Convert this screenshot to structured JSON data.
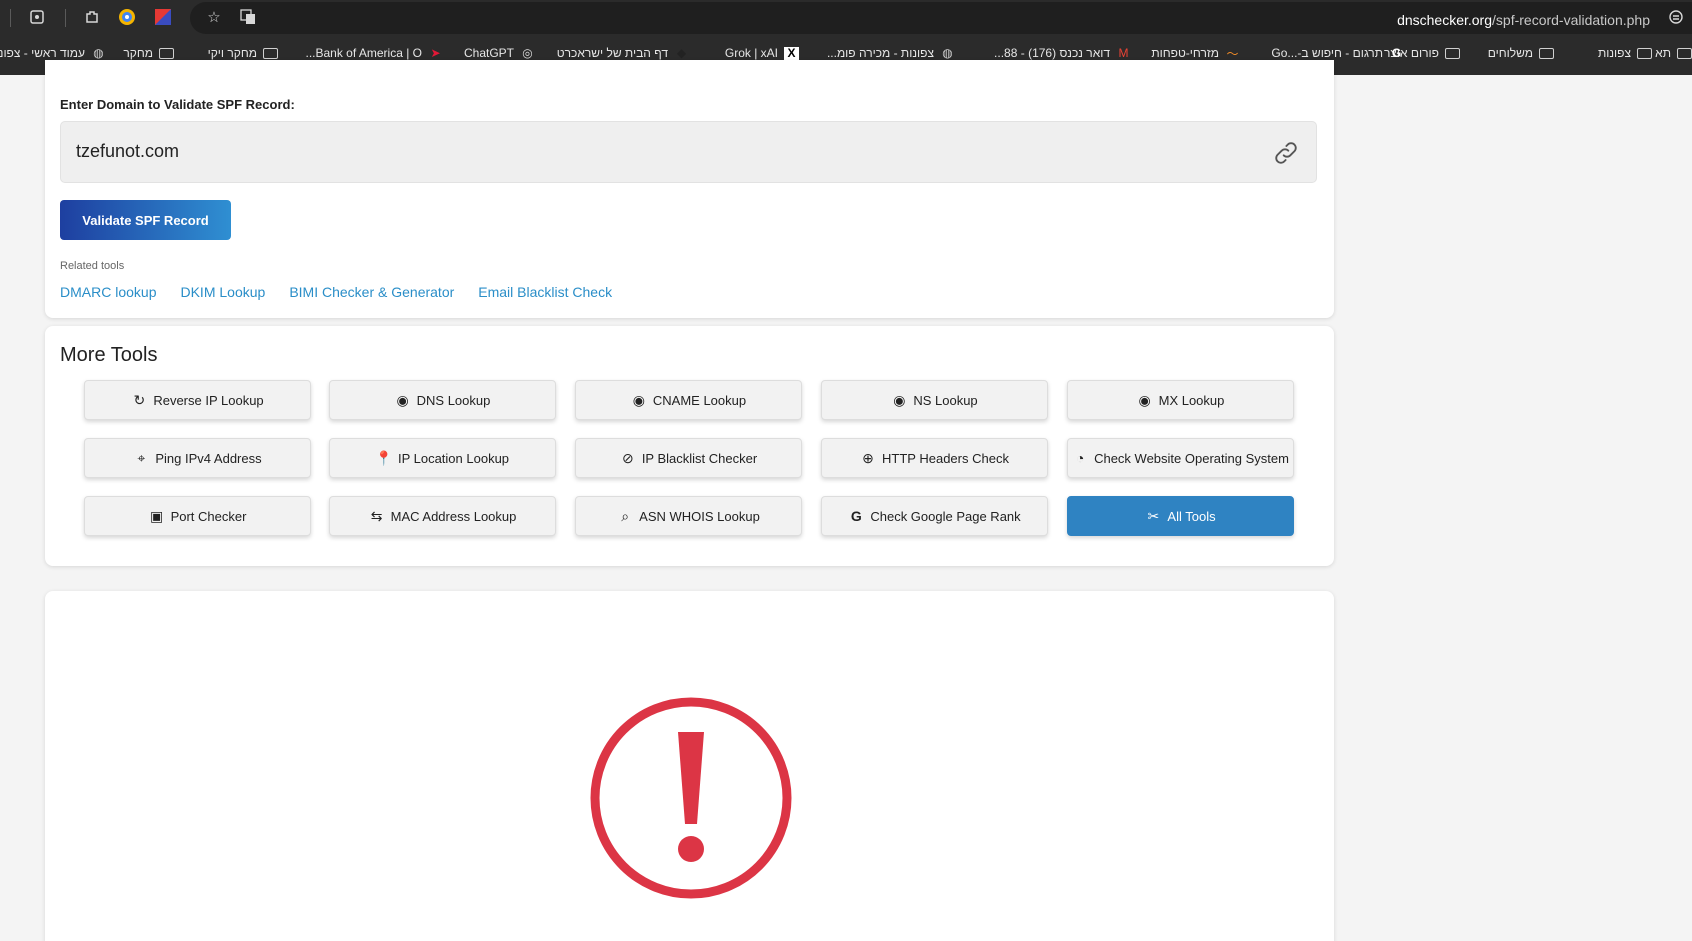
{
  "browser": {
    "url_host": "dnschecker.org",
    "url_path": "/spf-record-validation.php"
  },
  "bookmarks": [
    {
      "label": "תא",
      "icon": "folder-icon"
    },
    {
      "label": "צפונות",
      "icon": "folder-icon"
    },
    {
      "label": "משלוחים",
      "icon": "folder-icon"
    },
    {
      "label": "פורום אוצר",
      "icon": "folder-icon"
    },
    {
      "label": "תרגום - חיפוש ב-...Go",
      "icon": "google-icon"
    },
    {
      "label": "מזרחי-טפחות",
      "icon": "bank-icon"
    },
    {
      "label": "דואר נכנס (176) - 88...",
      "icon": "gmail-icon"
    },
    {
      "label": "צפונות - מכירה פומ...",
      "icon": "globe-icon"
    },
    {
      "label": "Grok | xAI",
      "icon": "x-icon"
    },
    {
      "label": "דף הבית של ישראכרט",
      "icon": "isracard-icon"
    },
    {
      "label": "ChatGPT",
      "icon": "chatgpt-icon"
    },
    {
      "label": "Bank of America | O...",
      "icon": "boa-icon"
    },
    {
      "label": "מחקר ויקי",
      "icon": "folder-icon"
    },
    {
      "label": "מחקר",
      "icon": "folder-icon"
    },
    {
      "label": "עמוד ראשי - צפונות...",
      "icon": "globe-icon"
    }
  ],
  "form": {
    "label": "Enter Domain to Validate SPF Record:",
    "domain_value": "tzefunot.com",
    "validate_label": "Validate SPF Record",
    "related_title": "Related tools",
    "related_links": [
      "DMARC lookup",
      "DKIM Lookup",
      "BIMI Checker & Generator",
      "Email Blacklist Check"
    ]
  },
  "more_tools": {
    "title": "More Tools",
    "rows": [
      [
        {
          "label": "Reverse IP Lookup",
          "icon": "refresh-icon"
        },
        {
          "label": "DNS Lookup",
          "icon": "dns-icon"
        },
        {
          "label": "CNAME Lookup",
          "icon": "dns-icon"
        },
        {
          "label": "NS Lookup",
          "icon": "dns-icon"
        },
        {
          "label": "MX Lookup",
          "icon": "dns-icon"
        }
      ],
      [
        {
          "label": "Ping IPv4 Address",
          "icon": "pin-outline-icon"
        },
        {
          "label": "IP Location Lookup",
          "icon": "pin-icon"
        },
        {
          "label": "IP Blacklist Checker",
          "icon": "ban-icon"
        },
        {
          "label": "HTTP Headers Check",
          "icon": "globe-icon"
        },
        {
          "label": "Check Website Operating System",
          "icon": "os-icon"
        }
      ],
      [
        {
          "label": "Port Checker",
          "icon": "port-icon"
        },
        {
          "label": "MAC Address Lookup",
          "icon": "mac-icon"
        },
        {
          "label": "ASN WHOIS Lookup",
          "icon": "search-icon"
        },
        {
          "label": "Check Google Page Rank",
          "icon": "google-icon"
        },
        {
          "label": "All Tools",
          "icon": "tools-icon"
        }
      ]
    ]
  },
  "colors": {
    "accent": "#2f83c2",
    "link": "#2a8ec8",
    "alert": "#dc3545"
  }
}
